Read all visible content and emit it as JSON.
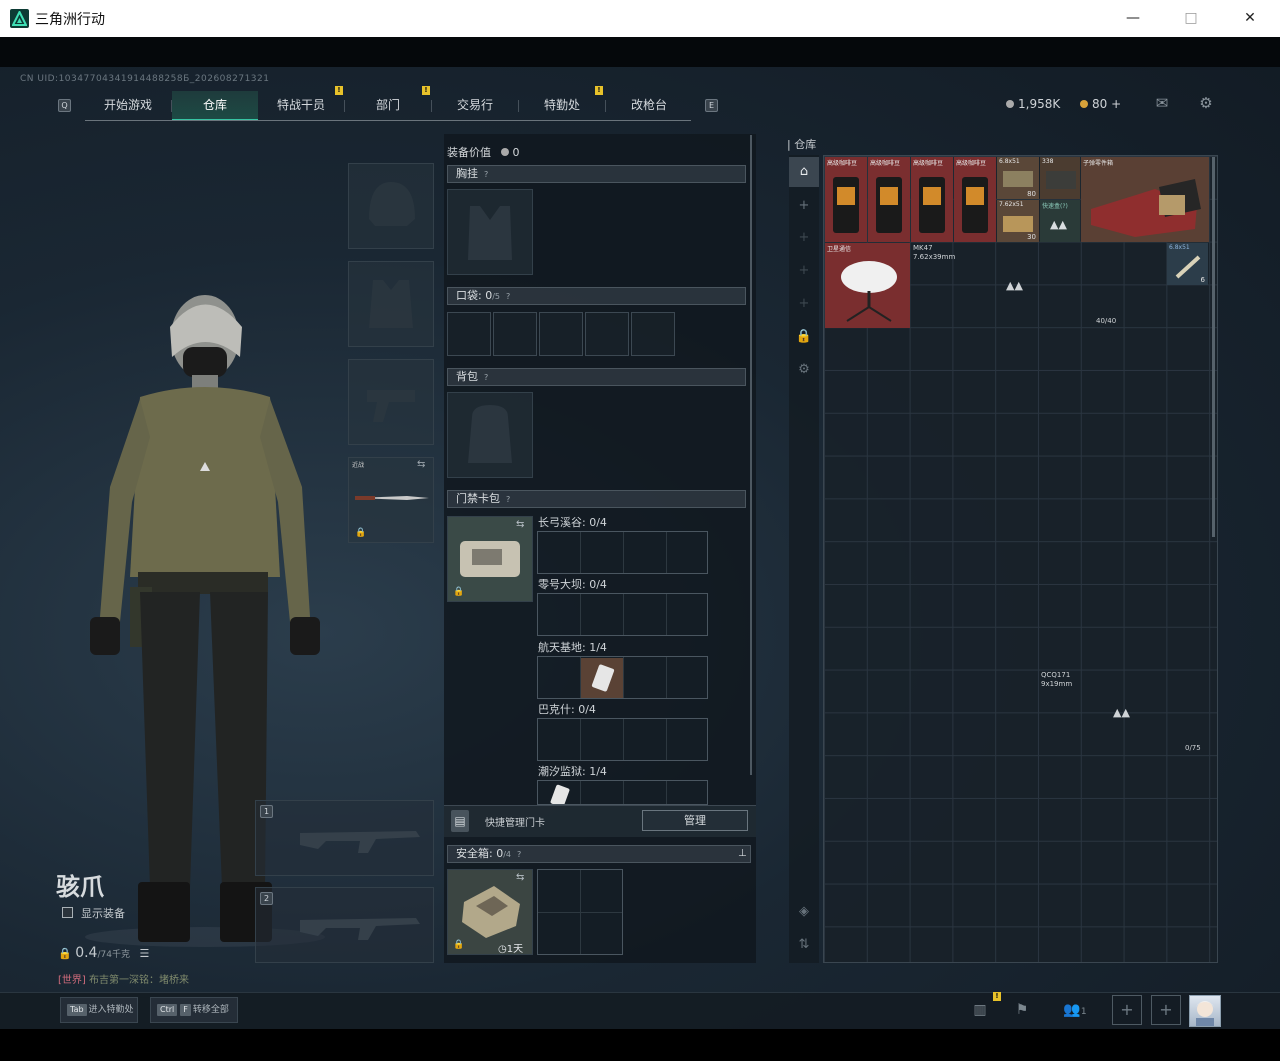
{
  "window": {
    "title": "三角洲行动",
    "minimize": "—",
    "maximize": "□",
    "close": "✕"
  },
  "uid": "CN UID:10347704341914488258Б_202608271321",
  "nav": {
    "left_key": "Q",
    "right_key": "E",
    "tabs": [
      "开始游戏",
      "仓库",
      "特战干员",
      "部门",
      "交易行",
      "特勤处",
      "改枪台"
    ],
    "active_tab": "仓库",
    "badges": [
      "!",
      "!",
      "!"
    ]
  },
  "currency": {
    "hafu_coin": "1,958K",
    "delta_coin": "80",
    "add": "+"
  },
  "top_icons": [
    "mail-icon",
    "gear-icon"
  ],
  "operator": {
    "name": "骇爪",
    "show_equipment": "显示装备",
    "weight_value": "0.4",
    "weight_total": "/74千克",
    "world_chat_prefix": "[世界]",
    "world_chat_text": "布吉第一深铭：堵桥来"
  },
  "equip_slots": {
    "melee_label": "近战"
  },
  "weapon_slots": [
    "1",
    "2"
  ],
  "loadout": {
    "value_label": "装备价值",
    "value": "0",
    "chest_rig": "胸挂",
    "pockets": "口袋:",
    "pockets_count": "0",
    "pockets_total": "/5",
    "backpack": "背包",
    "keycard_pack": "门禁卡包",
    "keycard_maps": [
      {
        "label": "长弓溪谷: 0/4"
      },
      {
        "label": "零号大坝: 0/4"
      },
      {
        "label": "航天基地: 1/4"
      },
      {
        "label": "巴克什: 0/4"
      },
      {
        "label": "潮汐监狱: 1/4"
      }
    ],
    "quick_manage_label": "快捷管理门卡",
    "manage_button": "管理",
    "safe_box": "安全箱:",
    "safe_box_count": "0",
    "safe_box_total": "/4",
    "safe_box_time": "1天",
    "help": "?"
  },
  "stash": {
    "title": "仓库",
    "items": [
      {
        "name": "高级咖啡豆",
        "count": ""
      },
      {
        "name": "高级咖啡豆",
        "count": ""
      },
      {
        "name": "高级咖啡豆",
        "count": ""
      },
      {
        "name": "高级咖啡豆",
        "count": ""
      },
      {
        "name": "6.8x51",
        "count": "80"
      },
      {
        "name": "338",
        "count": ""
      },
      {
        "name": "子弹零件箱",
        "count": ""
      },
      {
        "name": "7.62x51",
        "count": "30"
      },
      {
        "name": "快速盒(?)",
        "count": ""
      },
      {
        "name": "卫星通信",
        "count": ""
      },
      {
        "name": "6.8x51",
        "count": "6"
      }
    ],
    "mk47_name": "MK47",
    "mk47_caliber": "7.62x39mm",
    "mk47_capacity": "40/40",
    "qcq_name": "QCQ171",
    "qcq_caliber": "9x19mm",
    "qcq_capacity": "0/75"
  },
  "footer": {
    "tab_key": "Tab",
    "tab_label": "进入特勤处",
    "ctrl_key": "Ctrl",
    "f_key": "F",
    "transfer_label": "转移全部",
    "friends_count": "1",
    "badge": "!"
  }
}
